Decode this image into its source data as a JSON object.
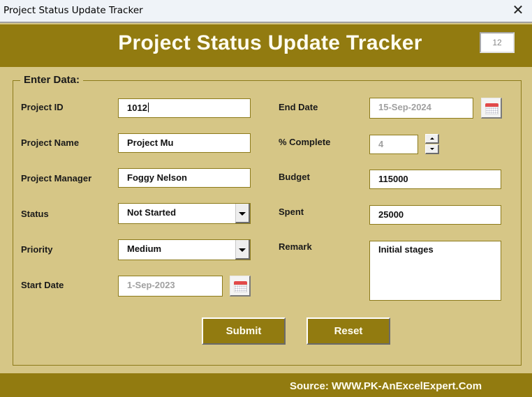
{
  "window": {
    "title": "Project Status Update Tracker",
    "close_icon": "close-icon"
  },
  "header": {
    "title": "Project Status Update Tracker",
    "record_counter": "12"
  },
  "form": {
    "legend": "Enter Data:",
    "project_id": {
      "label": "Project ID",
      "value": "1012"
    },
    "project_name": {
      "label": "Project Name",
      "value": "Project Mu"
    },
    "project_manager": {
      "label": "Project Manager",
      "value": "Foggy Nelson"
    },
    "status": {
      "label": "Status",
      "value": "Not Started"
    },
    "priority": {
      "label": "Priority",
      "value": "Medium"
    },
    "start_date": {
      "label": "Start Date",
      "value": "1-Sep-2023"
    },
    "end_date": {
      "label": "End Date",
      "value": "15-Sep-2024"
    },
    "percent_complete": {
      "label": "% Complete",
      "value": "4"
    },
    "budget": {
      "label": "Budget",
      "value": "115000"
    },
    "spent": {
      "label": "Spent",
      "value": "25000"
    },
    "remark": {
      "label": "Remark",
      "value": "Initial stages"
    }
  },
  "buttons": {
    "submit": "Submit",
    "reset": "Reset"
  },
  "footer": {
    "source": "Source: WWW.PK-AnExcelExpert.Com"
  },
  "colors": {
    "accent": "#927b10",
    "background": "#d6c686",
    "border": "#8c7a1a"
  }
}
